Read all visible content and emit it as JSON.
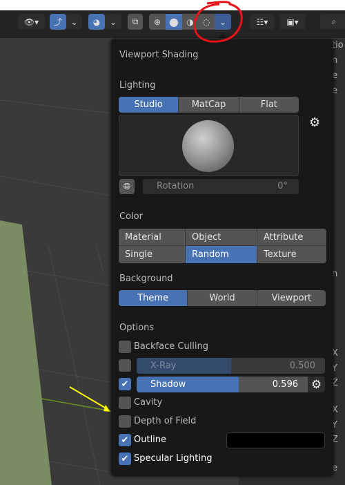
{
  "toolbar": {
    "buttons": [
      {
        "icon": "eye-select-icon"
      },
      {
        "icon": "gizmo-icon",
        "active": true
      },
      {
        "icon": "overlay-icon",
        "active": true
      },
      {
        "icon": "xray-toggle-icon"
      },
      {
        "icon": "wireframe-shading-icon"
      },
      {
        "icon": "solid-shading-icon",
        "active": true
      },
      {
        "icon": "material-preview-icon"
      },
      {
        "icon": "rendered-shading-icon"
      },
      {
        "icon": "shading-dropdown-icon",
        "active": true
      },
      {
        "icon": "editor-type-icon"
      },
      {
        "icon": "display-mode-icon"
      },
      {
        "icon": "search-icon"
      }
    ]
  },
  "right_panel": {
    "fragments": [
      "tio",
      "n",
      "e",
      "e",
      "n",
      "X",
      "Y",
      "Z",
      "X",
      "Y",
      "Z",
      "e"
    ]
  },
  "popup": {
    "title": "Viewport Shading",
    "lighting": {
      "label": "Lighting",
      "options": [
        "Studio",
        "MatCap",
        "Flat"
      ],
      "selected": "Studio",
      "rotation_label": "Rotation",
      "rotation_value": "0°"
    },
    "color": {
      "label": "Color",
      "options": [
        "Material",
        "Object",
        "Attribute",
        "Single",
        "Random",
        "Texture"
      ],
      "selected": "Random"
    },
    "background": {
      "label": "Background",
      "options": [
        "Theme",
        "World",
        "Viewport"
      ],
      "selected": "Theme"
    },
    "options": {
      "label": "Options",
      "backface_culling": {
        "label": "Backface Culling",
        "checked": false
      },
      "xray": {
        "label": "X-Ray",
        "checked": false,
        "value": "0.500",
        "fraction": 0.5
      },
      "shadow": {
        "label": "Shadow",
        "checked": true,
        "value": "0.596",
        "fraction": 0.596
      },
      "cavity": {
        "label": "Cavity",
        "checked": false
      },
      "dof": {
        "label": "Depth of Field",
        "checked": false
      },
      "outline": {
        "label": "Outline",
        "checked": true,
        "color": "#000000"
      },
      "specular": {
        "label": "Specular Lighting",
        "checked": true
      }
    }
  },
  "colors": {
    "accent": "#4772b3",
    "annotation_circle": "#e8141a",
    "annotation_arrow": "#ffff00",
    "plane": "#7b8b62"
  }
}
